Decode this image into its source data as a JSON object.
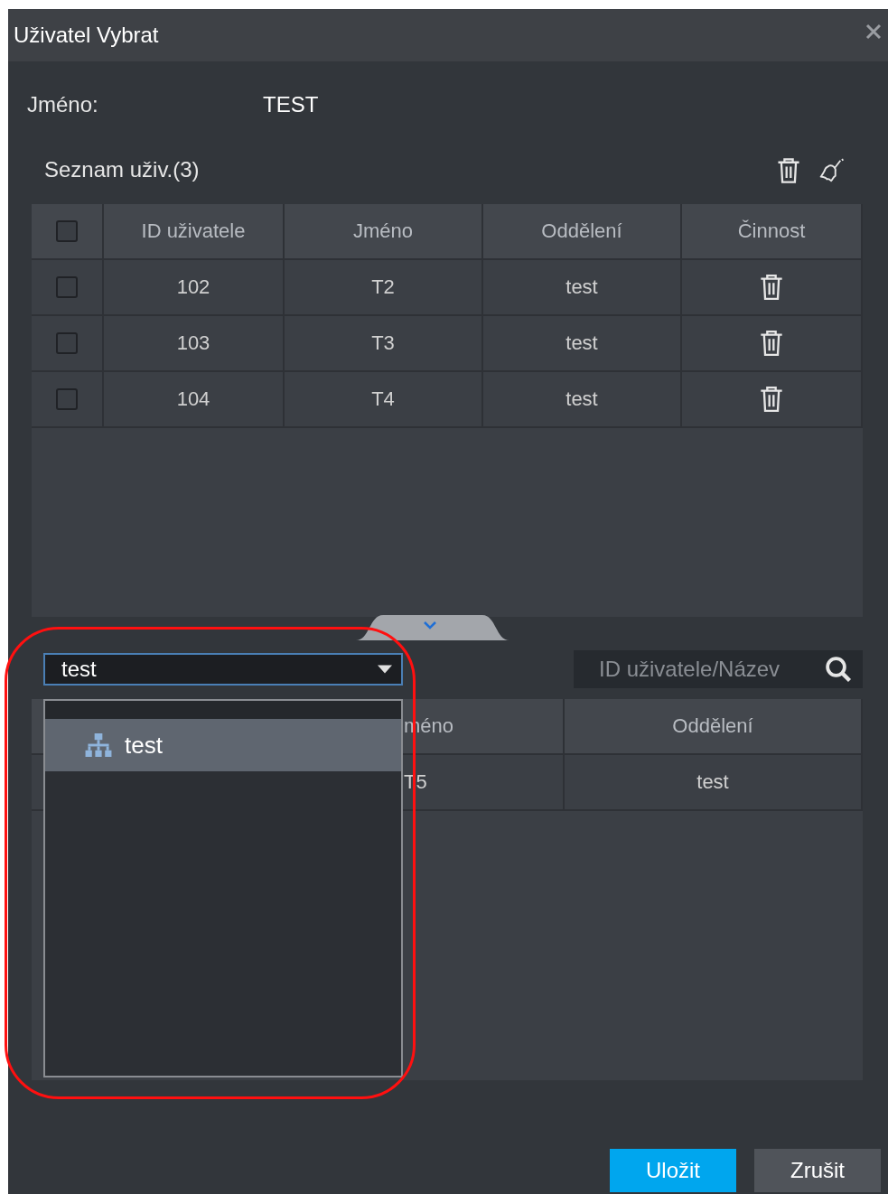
{
  "window": {
    "title": "Uživatel Vybrat"
  },
  "name_field": {
    "label": "Jméno:",
    "value": "TEST"
  },
  "user_list": {
    "title": "Seznam uživ.(3)",
    "header_checked": false,
    "columns": [
      "ID uživatele",
      "Jméno",
      "Oddělení",
      "Činnost"
    ],
    "rows": [
      {
        "id": "102",
        "name": "T2",
        "department": "test",
        "checked": false
      },
      {
        "id": "103",
        "name": "T3",
        "department": "test",
        "checked": false
      },
      {
        "id": "104",
        "name": "T4",
        "department": "test",
        "checked": false
      }
    ]
  },
  "department_select": {
    "value": "test",
    "open": true,
    "options": [
      {
        "label": "test",
        "selected": true
      }
    ]
  },
  "search": {
    "placeholder": "ID uživatele/Název"
  },
  "candidates": {
    "columns": [
      "méno",
      "Oddělení"
    ],
    "rows": [
      {
        "name": "T5",
        "department": "test"
      }
    ]
  },
  "buttons": [
    {
      "label": "Uložit",
      "kind": "primary"
    },
    {
      "label": "Zrušit",
      "kind": "secondary"
    }
  ]
}
